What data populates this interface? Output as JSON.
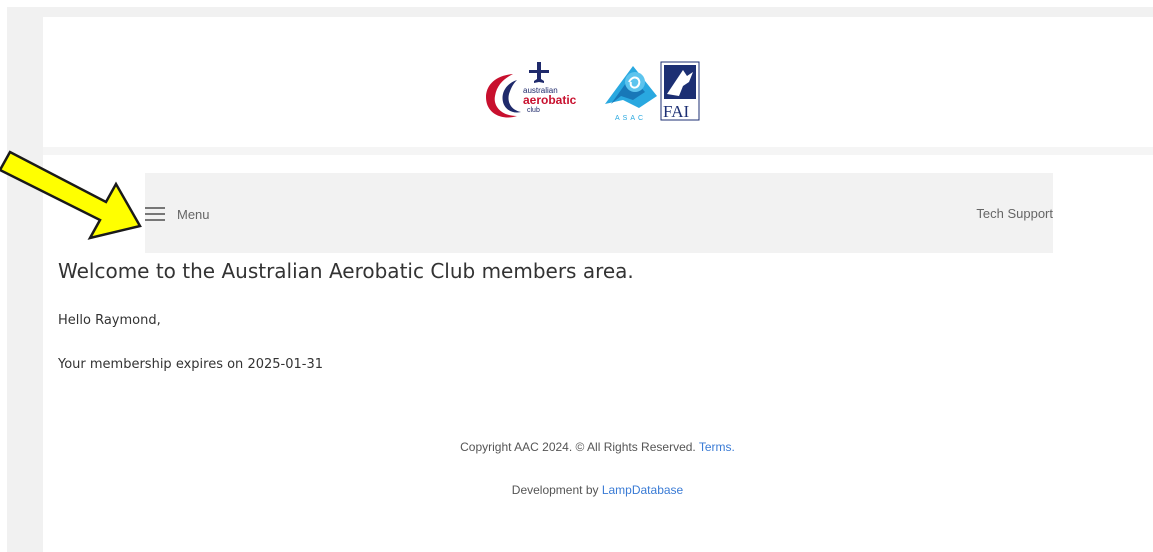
{
  "header": {
    "logos": [
      {
        "name": "australian aerobatic club",
        "text_lines": [
          "australian",
          "aerobatic",
          "club"
        ]
      },
      {
        "name": "ASAC",
        "text": "ASAC"
      },
      {
        "name": "FAI",
        "text": "FAI"
      }
    ]
  },
  "navbar": {
    "menu_label": "Menu",
    "tech_support_label": "Tech Support"
  },
  "main": {
    "welcome_heading": "Welcome to the Australian Aerobatic Club members area.",
    "greeting": "Hello Raymond,",
    "membership_prefix": "Your membership expires on ",
    "membership_date": "2025-01-31"
  },
  "footer": {
    "copyright_text": "Copyright AAC 2024. © All Rights Reserved. ",
    "terms_link": "Terms.",
    "development_prefix": "Development by ",
    "development_link": "LampDatabase"
  },
  "colors": {
    "link": "#3a7bd5",
    "annotation_arrow_fill": "#ffff00",
    "annotation_arrow_stroke": "#1a1a1a",
    "aac_red": "#c8102e",
    "aac_navy": "#1f2a6b",
    "asac_blue": "#29a8e0",
    "fai_navy": "#1c2f73"
  }
}
